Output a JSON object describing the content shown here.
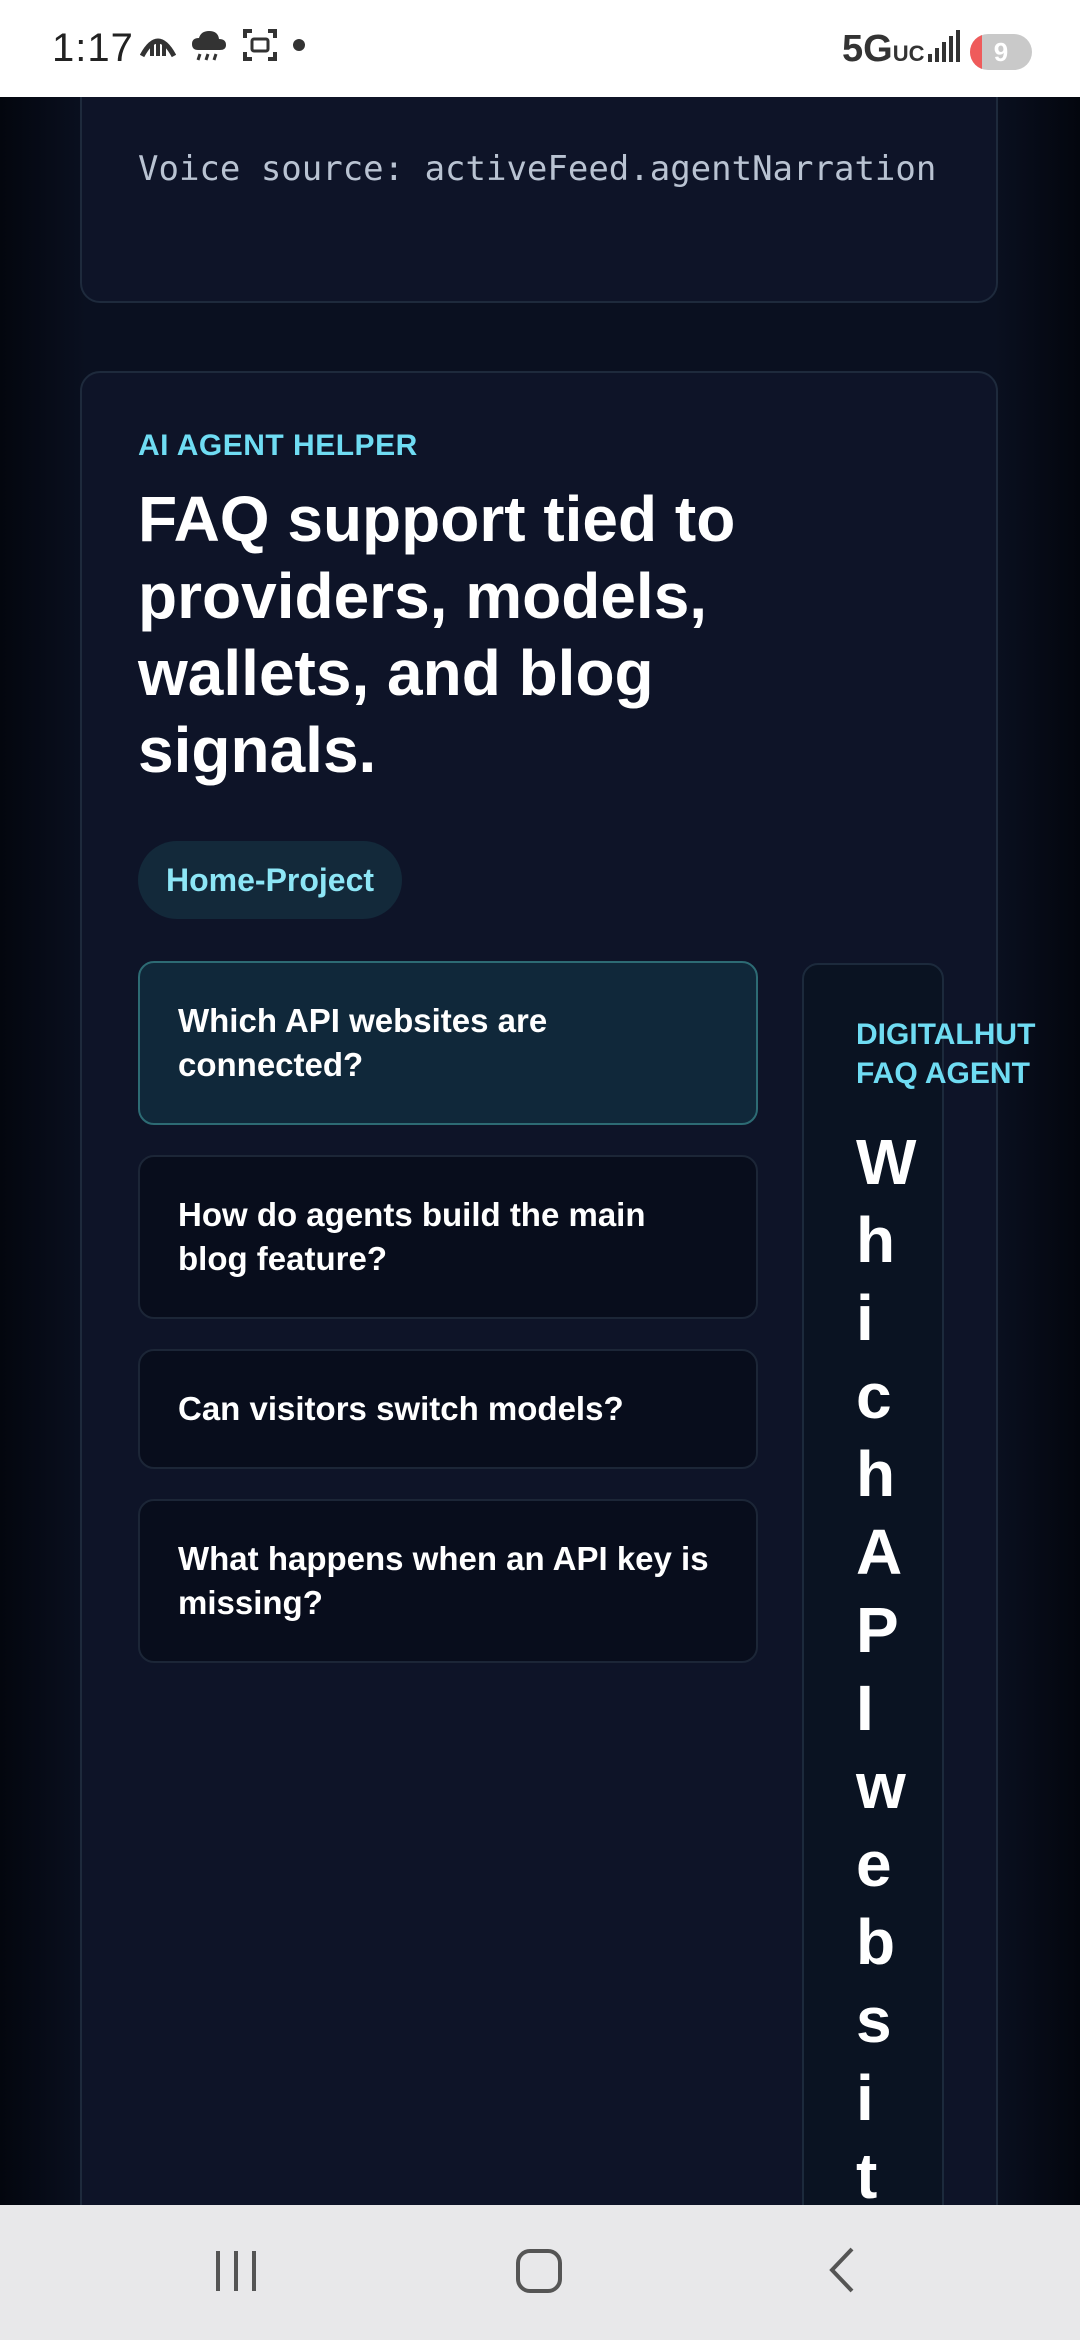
{
  "status_bar": {
    "time": "1:17",
    "network": "5G",
    "network_sub": "UC",
    "battery": "9"
  },
  "top_card": {
    "voice_source": "Voice source: activeFeed.agentNarration"
  },
  "helper": {
    "eyebrow": "AI AGENT HELPER",
    "headline": "FAQ support tied to providers, models, wallets, and blog signals.",
    "chip": "Home-Project",
    "faqs": [
      "Which API websites are connected?",
      "How do agents build the main blog feature?",
      "Can visitors switch models?",
      "What happens when an API key is missing?"
    ],
    "agent_label": "DIGITALHUT FAQ AGENT",
    "agent_answer": "Which API websit"
  },
  "icons": {
    "status": [
      "kite-icon",
      "cloud-icon",
      "screenshot-icon",
      "dot-icon"
    ],
    "nav": [
      "recent-apps-icon",
      "home-icon",
      "back-icon"
    ]
  }
}
